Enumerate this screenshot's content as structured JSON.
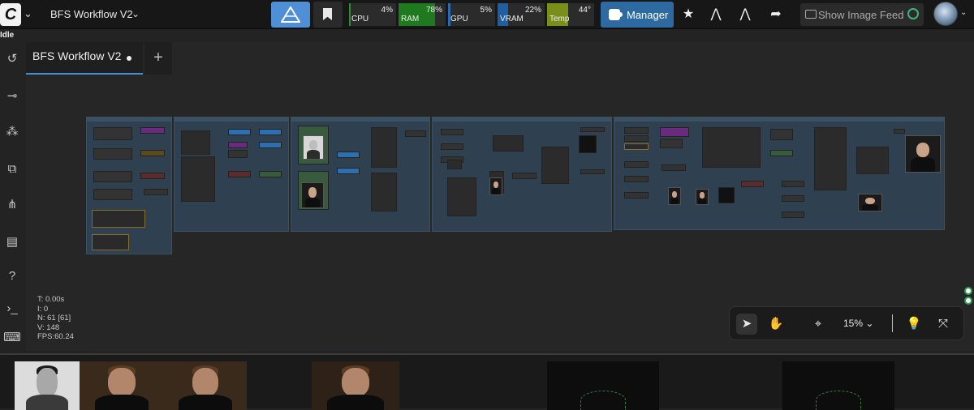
{
  "topbar": {
    "workflow_title": "BFS Workflow V2",
    "monitors": [
      {
        "label": "CPU",
        "value": "4%",
        "fill_fraction": 0.04,
        "color": "#2f8f2f"
      },
      {
        "label": "RAM",
        "value": "78%",
        "fill_fraction": 0.78,
        "color": "#1f7a1f"
      },
      {
        "label": "GPU",
        "value": "5%",
        "fill_fraction": 0.05,
        "color": "#2a6cb3"
      },
      {
        "label": "VRAM",
        "value": "22%",
        "fill_fraction": 0.22,
        "color": "#1f5f9f"
      },
      {
        "label": "Temp",
        "value": "44°",
        "fill_fraction": 0.44,
        "color": "#7a8f1a"
      }
    ],
    "manager_label": "Manager",
    "feed_label": "Show Image Feed"
  },
  "status": "Idle",
  "tabs": [
    {
      "label": "BFS Workflow V2",
      "modified": true
    }
  ],
  "canvas_stats": {
    "t": "T: 0.00s",
    "i": "I: 0",
    "n": "N: 61 [61]",
    "v": "V: 148",
    "fps": "FPS:60.24"
  },
  "toolbar": {
    "zoom": "15%"
  },
  "sidebar_icons": [
    "history-icon",
    "queue-icon",
    "node-library-icon",
    "model-library-icon",
    "workflows-icon",
    "templates-icon",
    "help-icon",
    "terminal-icon",
    "keyboard-icon"
  ]
}
